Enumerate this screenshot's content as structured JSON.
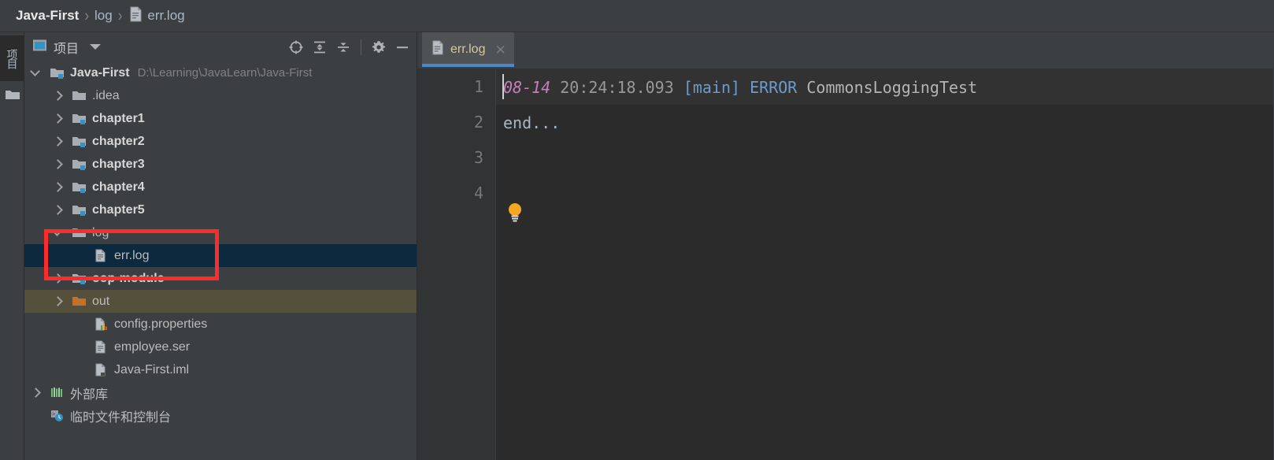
{
  "breadcrumb": {
    "root": "Java-First",
    "separator": "›",
    "folder": "log",
    "file": "err.log",
    "file_icon": "log-file-icon"
  },
  "tool_strip": {
    "items": [
      {
        "label": "项目",
        "name": "project-tool-window-button",
        "icon": "project-icon"
      },
      {
        "label": "",
        "name": "structure-tool-window-button",
        "icon": "folder-icon"
      }
    ]
  },
  "project_panel": {
    "title": "项目",
    "title_icon": "project-view-icon",
    "dropdown_icon": "chevron-down-icon",
    "actions": [
      {
        "name": "scroll-from-source-button",
        "icon": "crosshair-icon",
        "label": ""
      },
      {
        "name": "expand-all-button",
        "icon": "expand-all-icon",
        "label": ""
      },
      {
        "name": "collapse-all-button",
        "icon": "collapse-all-icon",
        "label": ""
      },
      {
        "name": "settings-button",
        "icon": "gear-icon",
        "label": ""
      },
      {
        "name": "hide-panel-button",
        "icon": "minimize-icon",
        "label": ""
      }
    ]
  },
  "tree": {
    "rows": [
      {
        "label": "Java-First",
        "path": "D:\\Learning\\JavaLearn\\Java-First",
        "icon": "module-folder-icon",
        "arrow": "down",
        "indent": 0,
        "bold": true,
        "state": "normal",
        "name": "tree-row-java-first"
      },
      {
        "label": ".idea",
        "path": "",
        "icon": "folder-icon",
        "arrow": "right",
        "indent": 1,
        "bold": false,
        "state": "normal",
        "name": "tree-row-idea"
      },
      {
        "label": "chapter1",
        "path": "",
        "icon": "module-folder-icon",
        "arrow": "right",
        "indent": 1,
        "bold": true,
        "state": "normal",
        "name": "tree-row-chapter1"
      },
      {
        "label": "chapter2",
        "path": "",
        "icon": "module-folder-icon",
        "arrow": "right",
        "indent": 1,
        "bold": true,
        "state": "normal",
        "name": "tree-row-chapter2"
      },
      {
        "label": "chapter3",
        "path": "",
        "icon": "module-folder-icon",
        "arrow": "right",
        "indent": 1,
        "bold": true,
        "state": "normal",
        "name": "tree-row-chapter3"
      },
      {
        "label": "chapter4",
        "path": "",
        "icon": "module-folder-icon",
        "arrow": "right",
        "indent": 1,
        "bold": true,
        "state": "normal",
        "name": "tree-row-chapter4"
      },
      {
        "label": "chapter5",
        "path": "",
        "icon": "module-folder-icon",
        "arrow": "right",
        "indent": 1,
        "bold": true,
        "state": "normal",
        "name": "tree-row-chapter5"
      },
      {
        "label": "log",
        "path": "",
        "icon": "folder-icon",
        "arrow": "down",
        "indent": 1,
        "bold": false,
        "state": "normal",
        "name": "tree-row-log"
      },
      {
        "label": "err.log",
        "path": "",
        "icon": "log-file-icon",
        "arrow": "none",
        "indent": 2,
        "bold": false,
        "state": "selected",
        "name": "tree-row-err-log"
      },
      {
        "label": "oop-module",
        "path": "",
        "icon": "module-folder-icon",
        "arrow": "right",
        "indent": 1,
        "bold": true,
        "state": "normal",
        "name": "tree-row-oop-module"
      },
      {
        "label": "out",
        "path": "",
        "icon": "excluded-folder-icon",
        "arrow": "right",
        "indent": 1,
        "bold": false,
        "state": "excluded",
        "name": "tree-row-out"
      },
      {
        "label": "config.properties",
        "path": "",
        "icon": "properties-file-icon",
        "arrow": "none",
        "indent": 2,
        "bold": false,
        "state": "normal",
        "name": "tree-row-config-properties"
      },
      {
        "label": "employee.ser",
        "path": "",
        "icon": "file-icon",
        "arrow": "none",
        "indent": 2,
        "bold": false,
        "state": "normal",
        "name": "tree-row-employee-ser"
      },
      {
        "label": "Java-First.iml",
        "path": "",
        "icon": "iml-file-icon",
        "arrow": "none",
        "indent": 2,
        "bold": false,
        "state": "normal",
        "name": "tree-row-java-first-iml"
      },
      {
        "label": "外部库",
        "path": "",
        "icon": "library-icon",
        "arrow": "right",
        "indent": 0,
        "bold": false,
        "state": "normal",
        "name": "tree-row-external-libraries"
      },
      {
        "label": "临时文件和控制台",
        "path": "",
        "icon": "scratches-icon",
        "arrow": "none",
        "indent": 0,
        "bold": false,
        "state": "normal",
        "name": "tree-row-scratches-and-consoles"
      }
    ]
  },
  "editor": {
    "tab": {
      "label": "err.log",
      "icon": "log-file-icon",
      "close_icon": "close-icon"
    },
    "gutter_lines": [
      "1",
      "2",
      "3",
      "4"
    ],
    "intention_icon": "lightbulb-icon",
    "lines": [
      {
        "number": "1",
        "current": true,
        "tokens": [
          {
            "text": "08-14",
            "type": "date"
          },
          {
            "text": " ",
            "type": "plain"
          },
          {
            "text": "20:24:18.093",
            "type": "time"
          },
          {
            "text": " ",
            "type": "plain"
          },
          {
            "text": "[main]",
            "type": "thread"
          },
          {
            "text": " ",
            "type": "plain"
          },
          {
            "text": "ERROR",
            "type": "level"
          },
          {
            "text": " ",
            "type": "plain"
          },
          {
            "text": "CommonsLoggingTest",
            "type": "logger"
          }
        ]
      },
      {
        "number": "2",
        "current": false,
        "tokens": [
          {
            "text": "end...",
            "type": "plain"
          }
        ]
      }
    ]
  },
  "annotation": {
    "name": "red-highlight-box",
    "color": "#fd2c2c"
  },
  "colors": {
    "panel_bg": "#3c3f41",
    "editor_bg": "#2b2b2b",
    "gutter_bg": "#313335",
    "selection_bg": "#0d293e",
    "excluded_bg": "#55503c",
    "tab_accent": "#4a88c7",
    "annotation": "#fd2c2c",
    "text": "#bbbbbb"
  }
}
